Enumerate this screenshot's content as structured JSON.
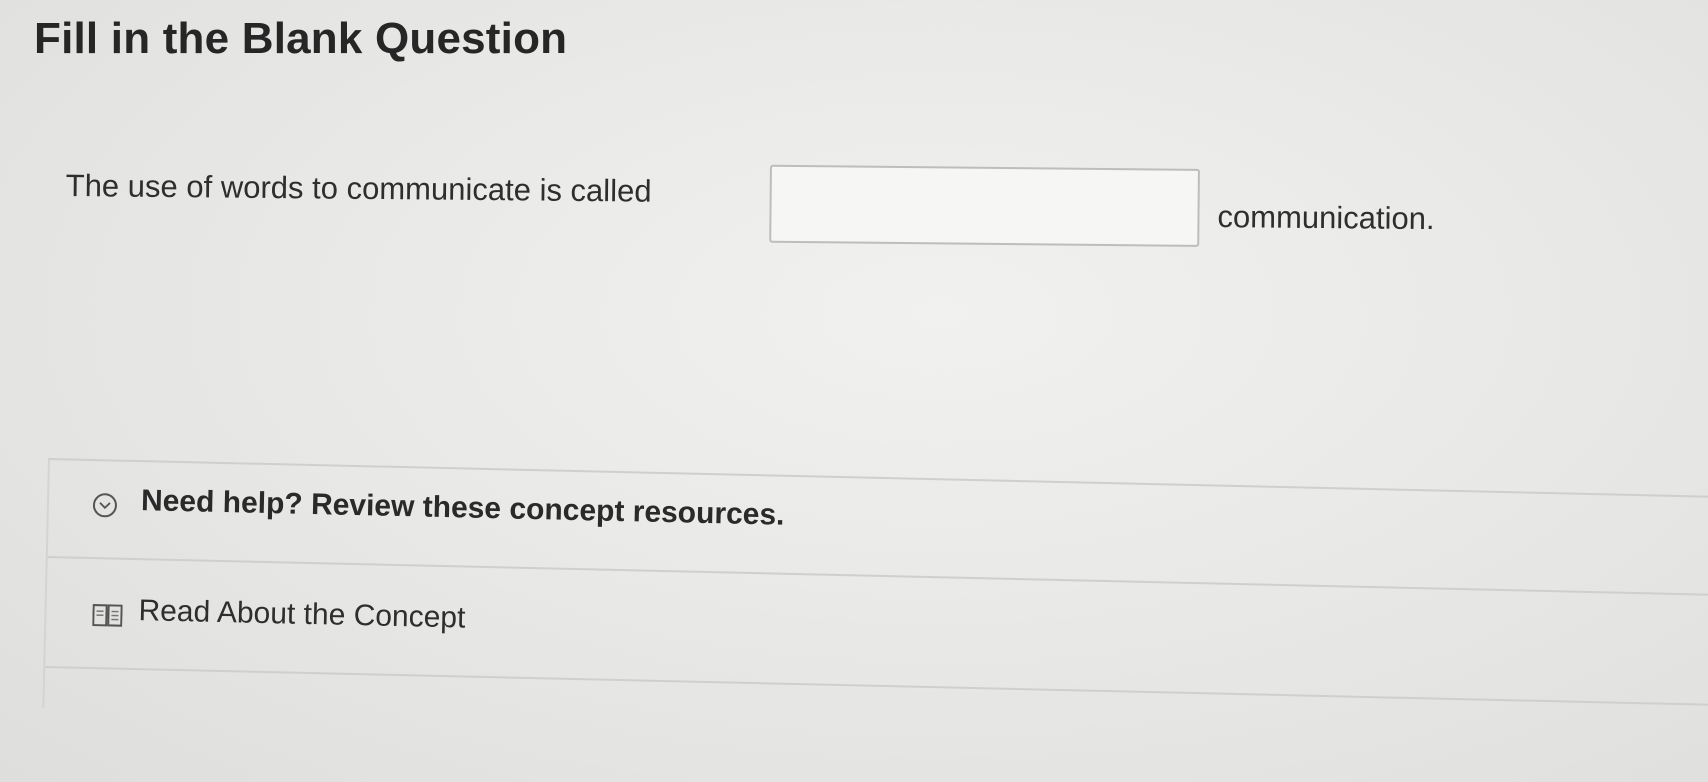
{
  "page": {
    "title": "Fill in the Blank Question"
  },
  "question": {
    "prefix": "The use of words to communicate is called",
    "blank_value": "",
    "suffix": "communication."
  },
  "help": {
    "title": "Need help? Review these concept resources.",
    "toggle_icon": "chevron-down-icon",
    "resources": [
      {
        "icon": "book-icon",
        "label": "Read About the Concept"
      }
    ]
  }
}
